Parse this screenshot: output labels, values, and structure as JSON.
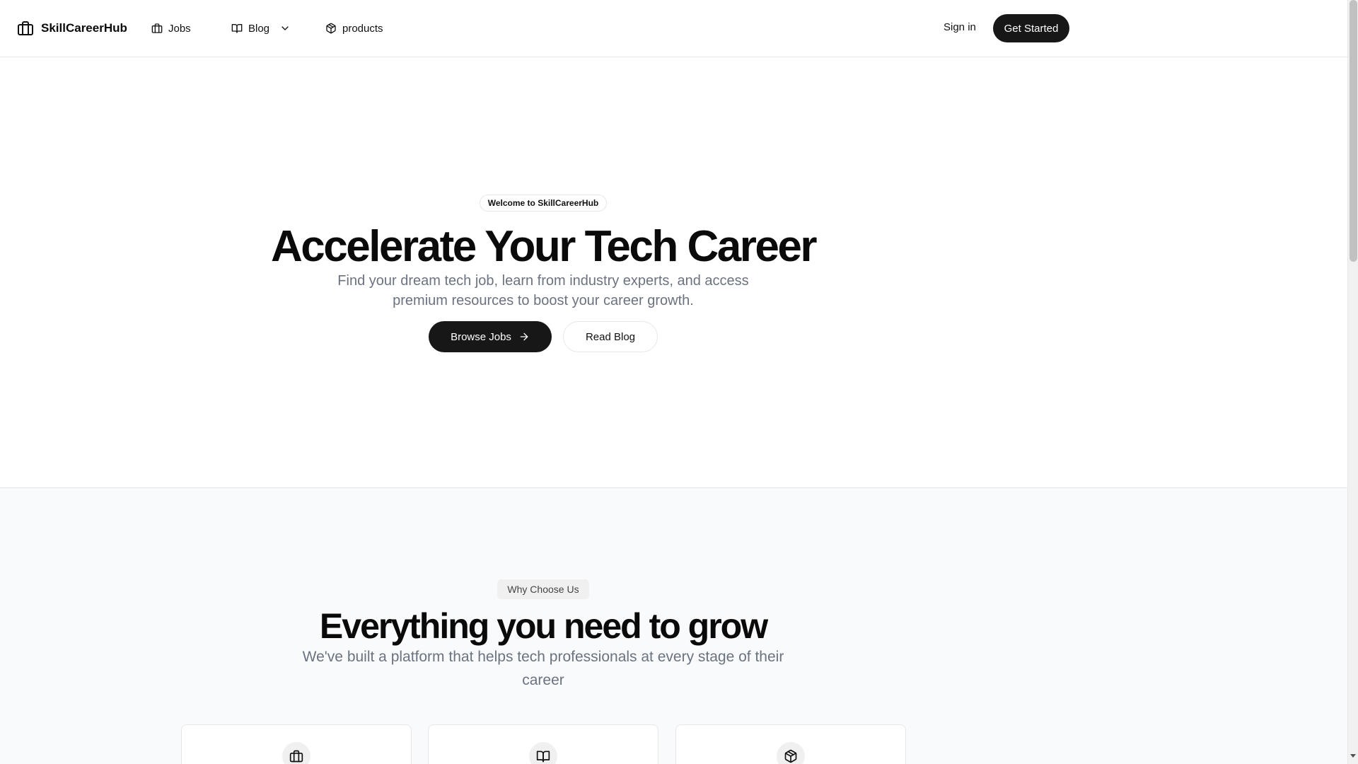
{
  "header": {
    "brand": "SkillCareerHub",
    "nav": {
      "jobs": "Jobs",
      "blog": "Blog",
      "products": "products"
    },
    "signin": "Sign in",
    "get_started": "Get Started"
  },
  "hero": {
    "badge": "Welcome to SkillCareerHub",
    "title": "Accelerate Your Tech Career",
    "subtitle": "Find your dream tech job, learn from industry experts, and access premium resources to boost your career growth.",
    "browse_jobs": "Browse Jobs",
    "read_blog": "Read Blog"
  },
  "features": {
    "tag": "Why Choose Us",
    "title": "Everything you need to grow",
    "subtitle": "We've built a platform that helps tech professionals at every stage of their career",
    "cards": [
      {
        "icon": "briefcase-icon"
      },
      {
        "icon": "book-open-icon"
      },
      {
        "icon": "package-icon"
      }
    ]
  },
  "colors": {
    "primary": "#171717",
    "muted_text": "#6b7280",
    "border": "#e5e7eb",
    "section_bg": "#f9fafb"
  }
}
